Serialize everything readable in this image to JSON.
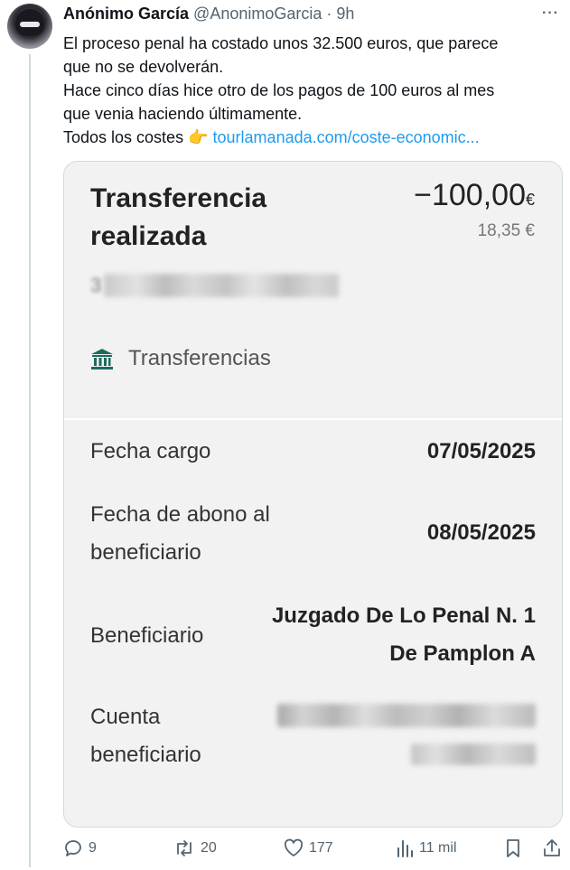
{
  "tweet": {
    "author_name": "Anónimo García",
    "handle": "@AnonimoGarcia",
    "separator": "·",
    "time": "9h",
    "more": "···",
    "text_lines": [
      "El proceso penal ha costado unos 32.500 euros, que parece",
      "que no se devolverán.",
      "Hace cinco días hice otro de los pagos de 100 euros al mes",
      "que venia haciendo últimamente.",
      "Todos los costes"
    ],
    "emoji": "👉",
    "link_text": "tourlamanada.com/coste-economic..."
  },
  "card": {
    "title": "Transferencia realizada",
    "amount": "−100,00",
    "amount_currency": "€",
    "sub_amount": "18,35 €",
    "blurred_first_char": "3",
    "category_icon": "bank-icon",
    "category": "Transferencias",
    "rows": {
      "fecha_cargo_label": "Fecha cargo",
      "fecha_cargo_value": "07/05/2025",
      "fecha_abono_label_1": "Fecha de abono al",
      "fecha_abono_label_2": "beneficiario",
      "fecha_abono_value": "08/05/2025",
      "beneficiario_label": "Beneficiario",
      "beneficiario_value_1": "Juzgado De Lo Penal N. 1",
      "beneficiario_value_2": "De Pamplon A",
      "cuenta_label_1": "Cuenta",
      "cuenta_label_2": "beneficiario"
    }
  },
  "actions": {
    "replies": "9",
    "retweets": "20",
    "likes": "177",
    "views": "11 mil"
  },
  "colors": {
    "link": "#1d9bf0",
    "muted": "#536471",
    "card_bg": "#f2f2f2",
    "bank_icon": "#1d6b5f"
  }
}
